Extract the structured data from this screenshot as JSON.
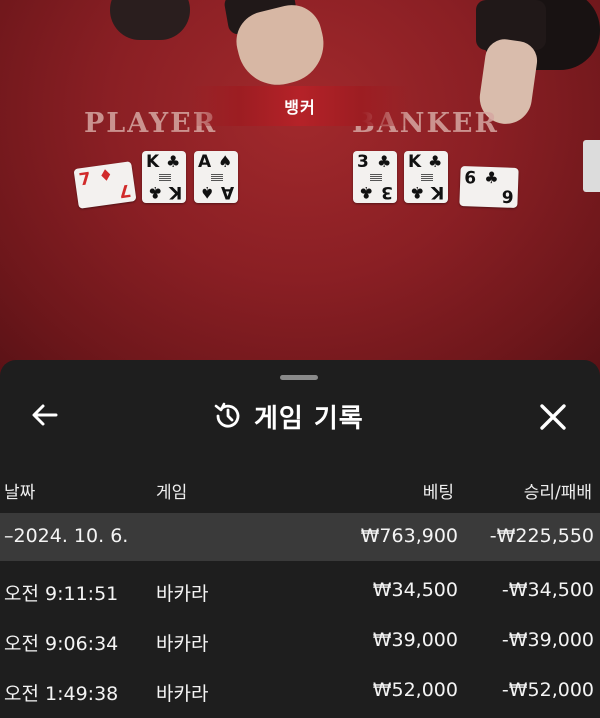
{
  "video": {
    "banner_label": "뱅커",
    "player_label": "PLAYER",
    "banker_label": "BANKER",
    "player_cards": [
      {
        "rank": "7",
        "suit": "♦",
        "color": "red"
      },
      {
        "rank": "K",
        "suit": "♣",
        "color": "black"
      },
      {
        "rank": "A",
        "suit": "♠",
        "color": "black"
      }
    ],
    "banker_cards": [
      {
        "rank": "3",
        "suit": "♣",
        "color": "black"
      },
      {
        "rank": "K",
        "suit": "♣",
        "color": "black"
      },
      {
        "rank": "6",
        "suit": "♣",
        "color": "black"
      }
    ]
  },
  "sheet": {
    "title": "게임 기록",
    "back_icon": "arrow-left-icon",
    "history_icon": "history-icon",
    "close_icon": "close-icon",
    "columns": {
      "date": "날짜",
      "game": "게임",
      "bet": "베팅",
      "result": "승리/패배"
    },
    "group_row": {
      "date": "–2024. 10. 6.",
      "bet": "₩763,900",
      "result": "-₩225,550"
    },
    "rows": [
      {
        "time": "오전 9:11:51",
        "game": "바카라",
        "bet": "₩34,500",
        "result": "-₩34,500"
      },
      {
        "time": "오전 9:06:34",
        "game": "바카라",
        "bet": "₩39,000",
        "result": "-₩39,000"
      },
      {
        "time": "오전 1:49:38",
        "game": "바카라",
        "bet": "₩52,000",
        "result": "-₩52,000"
      }
    ]
  },
  "colors": {
    "table_felt": "#8a1f24",
    "sheet_bg": "#1e1e1e",
    "group_row_bg": "#3a3a3a"
  }
}
